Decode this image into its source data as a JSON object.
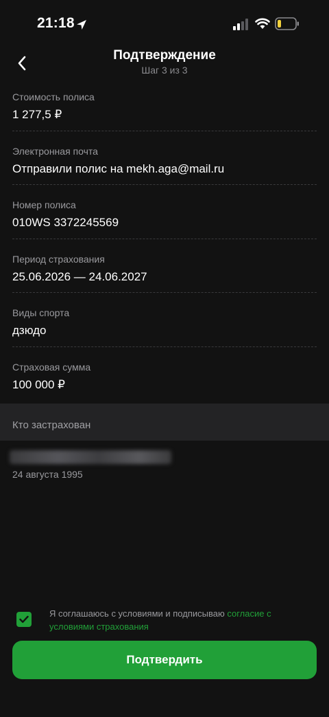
{
  "status_bar": {
    "time": "21:18",
    "icons": [
      "location-arrow-icon",
      "signal-icon",
      "wifi-icon",
      "battery-icon"
    ]
  },
  "header": {
    "back_icon": "chevron-left-icon",
    "title": "Подтверждение",
    "subtitle": "Шаг 3 из 3"
  },
  "details": [
    {
      "label": "Стоимость полиса",
      "value": "1 277,5 ₽"
    },
    {
      "label": "Электронная почта",
      "value": "Отправили полис на mekh.aga@mail.ru"
    },
    {
      "label": "Номер полиса",
      "value": "010WS 3372245569"
    },
    {
      "label": "Период страхования",
      "value": "25.06.2026 — 24.06.2027"
    },
    {
      "label": "Виды спорта",
      "value": "дзюдо"
    },
    {
      "label": "Страховая сумма",
      "value": "100 000 ₽"
    }
  ],
  "insured": {
    "section_title": "Кто застрахован",
    "birth_date": "24 августа 1995"
  },
  "consent": {
    "checked": true,
    "text": "Я соглашаюсь с условиями и подписываю ",
    "link_text": "согласие с условиями страхования"
  },
  "confirm_button": {
    "label": "Подтвердить"
  },
  "colors": {
    "background": "#121212",
    "accent": "#21a038",
    "section_bg": "#232325",
    "muted_text": "#9a9a9e"
  }
}
